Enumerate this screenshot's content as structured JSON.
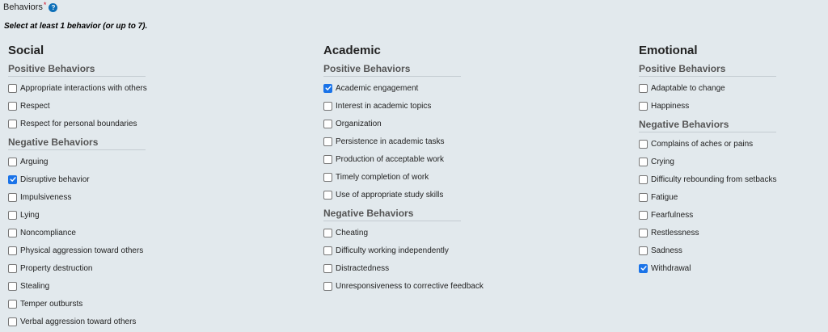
{
  "field": {
    "label": "Behaviors",
    "required_mark": "*",
    "help_glyph": "?"
  },
  "instruction": "Select at least 1 behavior (or up to 7).",
  "columns": [
    {
      "title": "Social",
      "groups": [
        {
          "title": "Positive Behaviors",
          "items": [
            {
              "label": "Appropriate interactions with others",
              "checked": false
            },
            {
              "label": "Respect",
              "checked": false
            },
            {
              "label": "Respect for personal boundaries",
              "checked": false
            }
          ]
        },
        {
          "title": "Negative Behaviors",
          "items": [
            {
              "label": "Arguing",
              "checked": false
            },
            {
              "label": "Disruptive behavior",
              "checked": true
            },
            {
              "label": "Impulsiveness",
              "checked": false
            },
            {
              "label": "Lying",
              "checked": false
            },
            {
              "label": "Noncompliance",
              "checked": false
            },
            {
              "label": "Physical aggression toward others",
              "checked": false
            },
            {
              "label": "Property destruction",
              "checked": false
            },
            {
              "label": "Stealing",
              "checked": false
            },
            {
              "label": "Temper outbursts",
              "checked": false
            },
            {
              "label": "Verbal aggression toward others",
              "checked": false
            }
          ]
        }
      ]
    },
    {
      "title": "Academic",
      "groups": [
        {
          "title": "Positive Behaviors",
          "items": [
            {
              "label": "Academic engagement",
              "checked": true
            },
            {
              "label": "Interest in academic topics",
              "checked": false
            },
            {
              "label": "Organization",
              "checked": false
            },
            {
              "label": "Persistence in academic tasks",
              "checked": false
            },
            {
              "label": "Production of acceptable work",
              "checked": false
            },
            {
              "label": "Timely completion of work",
              "checked": false
            },
            {
              "label": "Use of appropriate study skills",
              "checked": false
            }
          ]
        },
        {
          "title": "Negative Behaviors",
          "items": [
            {
              "label": "Cheating",
              "checked": false
            },
            {
              "label": "Difficulty working independently",
              "checked": false
            },
            {
              "label": "Distractedness",
              "checked": false
            },
            {
              "label": "Unresponsiveness to corrective feedback",
              "checked": false
            }
          ]
        }
      ]
    },
    {
      "title": "Emotional",
      "groups": [
        {
          "title": "Positive Behaviors",
          "items": [
            {
              "label": "Adaptable to change",
              "checked": false
            },
            {
              "label": "Happiness",
              "checked": false
            }
          ]
        },
        {
          "title": "Negative Behaviors",
          "items": [
            {
              "label": "Complains of aches or pains",
              "checked": false
            },
            {
              "label": "Crying",
              "checked": false
            },
            {
              "label": "Difficulty rebounding from setbacks",
              "checked": false
            },
            {
              "label": "Fatigue",
              "checked": false
            },
            {
              "label": "Fearfulness",
              "checked": false
            },
            {
              "label": "Restlessness",
              "checked": false
            },
            {
              "label": "Sadness",
              "checked": false
            },
            {
              "label": "Withdrawal",
              "checked": true
            }
          ]
        }
      ]
    }
  ],
  "colors": {
    "background": "#e2e9ed",
    "checkbox_checked": "#1a73e8",
    "help_icon": "#0d6fb8",
    "required": "#d0021b"
  }
}
